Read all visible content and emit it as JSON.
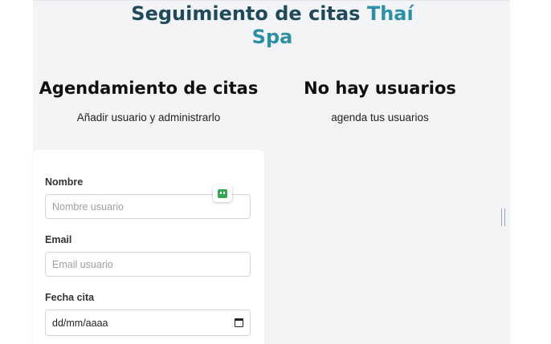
{
  "header": {
    "title_main": "Seguimiento de citas",
    "title_brand": "Thaí Spa"
  },
  "left": {
    "title": "Agendamiento de citas",
    "subtitle": "Añadir usuario y administrarlo"
  },
  "right": {
    "title": "No hay usuarios",
    "subtitle": "agenda tus usuarios"
  },
  "form": {
    "name_label": "Nombre",
    "name_placeholder": "Nombre usuario",
    "email_label": "Email",
    "email_placeholder": "Email usuario",
    "date_label": "Fecha cita",
    "date_value": "dd/mm/aaaa"
  },
  "icons": {
    "calendar": "calendar-icon",
    "extension": "password-manager-icon",
    "grip": "resize-handle-icon"
  },
  "colors": {
    "title_dark": "#1e4a5c",
    "title_brand": "#2b8fa8",
    "panel_bg": "#f3f4f6",
    "extension_green": "#34a853"
  }
}
